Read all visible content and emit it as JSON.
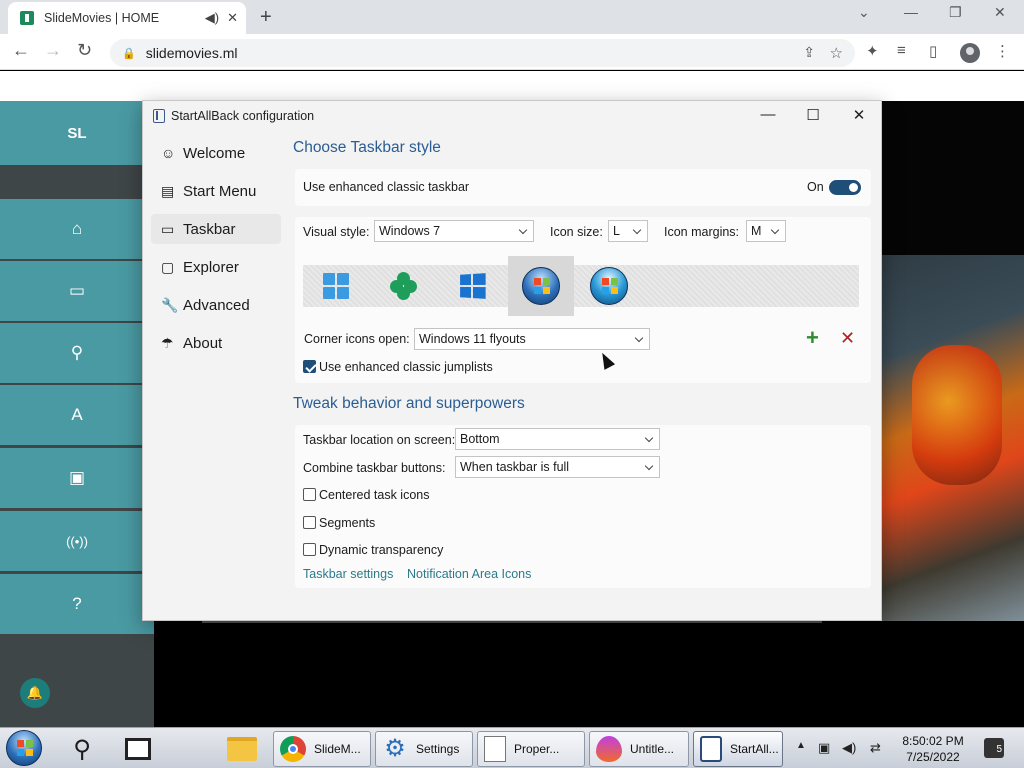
{
  "browser": {
    "tab_title": "SlideMovies | HOME",
    "url": "slidemovies.ml"
  },
  "site": {
    "logo": "SL",
    "nav": [
      {
        "icon": "home-icon",
        "glyph": "⌂"
      },
      {
        "icon": "tv-icon",
        "glyph": "▭"
      },
      {
        "icon": "search-icon",
        "glyph": "⚲"
      },
      {
        "icon": "font-icon",
        "glyph": "A"
      },
      {
        "icon": "image-icon",
        "glyph": "▣"
      },
      {
        "icon": "broadcast-icon",
        "glyph": "((•))"
      },
      {
        "icon": "help-icon",
        "glyph": "?"
      }
    ]
  },
  "window": {
    "title": "StartAllBack configuration",
    "nav": [
      {
        "label": "Welcome",
        "icon": "smile-icon",
        "glyph": "☺"
      },
      {
        "label": "Start Menu",
        "icon": "start-menu-icon",
        "glyph": "▤"
      },
      {
        "label": "Taskbar",
        "icon": "taskbar-icon",
        "glyph": "▭"
      },
      {
        "label": "Explorer",
        "icon": "folder-icon",
        "glyph": "▢"
      },
      {
        "label": "Advanced",
        "icon": "wrench-icon",
        "glyph": "🔧"
      },
      {
        "label": "About",
        "icon": "umbrella-icon",
        "glyph": "☂"
      }
    ],
    "active_nav": "Taskbar"
  },
  "style_section": {
    "title": "Choose Taskbar style",
    "enhanced_label": "Use enhanced classic taskbar",
    "toggle_label": "On",
    "toggle_on": true,
    "visual_style_label": "Visual style:",
    "visual_style_value": "Windows 7",
    "icon_size_label": "Icon size:",
    "icon_size_value": "L",
    "icon_margins_label": "Icon margins:",
    "icon_margins_value": "M",
    "styles": [
      "windows-11-logo",
      "clover-logo",
      "windows-10-logo",
      "windows-7-orb",
      "windows-vista-orb"
    ],
    "selected_style": "windows-7-orb",
    "corner_icons_label": "Corner icons open:",
    "corner_icons_value": "Windows 11 flyouts",
    "jumplists_label": "Use enhanced classic jumplists",
    "jumplists_checked": true
  },
  "behavior_section": {
    "title": "Tweak behavior and superpowers",
    "location_label": "Taskbar location on screen:",
    "location_value": "Bottom",
    "combine_label": "Combine taskbar buttons:",
    "combine_value": "When taskbar is full",
    "centered_label": "Centered task icons",
    "segments_label": "Segments",
    "dynamic_label": "Dynamic transparency",
    "link_taskbar_settings": "Taskbar settings",
    "link_notification_icons": "Notification Area Icons"
  },
  "taskbar": {
    "buttons": [
      {
        "label": "SlideM...",
        "icon": "chrome-icon"
      },
      {
        "label": "Settings",
        "icon": "settings-gear-icon"
      },
      {
        "label": "Proper...",
        "icon": "properties-icon"
      },
      {
        "label": "Untitle...",
        "icon": "paint-drop-icon"
      },
      {
        "label": "StartAll...",
        "icon": "startallback-icon"
      }
    ],
    "time": "8:50:02 PM",
    "date": "7/25/2022",
    "notification_count": "5"
  },
  "colors": {
    "accent": "#2a5d93",
    "toggle": "#1f4e79",
    "site_teal": "#4a9aa3",
    "add_green": "#2e8b2e",
    "remove_red": "#b22222"
  }
}
